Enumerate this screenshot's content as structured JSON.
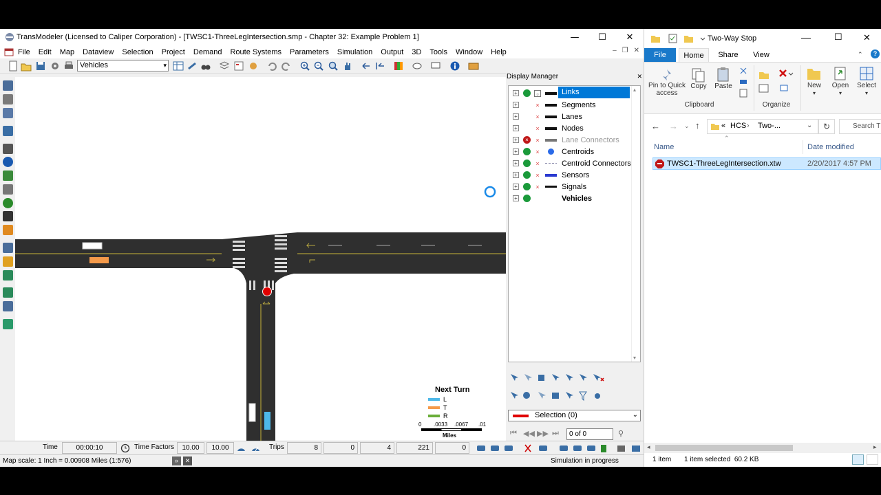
{
  "transmodeler": {
    "title": "TransModeler (Licensed to Caliper Corporation) - [TWSC1-ThreeLegIntersection.smp - Chapter 32: Example Problem 1]",
    "menu": [
      "File",
      "Edit",
      "Map",
      "Dataview",
      "Selection",
      "Project",
      "Demand",
      "Route Systems",
      "Parameters",
      "Simulation",
      "Output",
      "3D",
      "Tools",
      "Window",
      "Help"
    ],
    "layer_select": "Vehicles",
    "display_manager": {
      "title": "Display Manager",
      "layers": [
        {
          "label": "Links",
          "visible": true,
          "selected": true
        },
        {
          "label": "Segments",
          "visible": null
        },
        {
          "label": "Lanes",
          "visible": null
        },
        {
          "label": "Nodes",
          "visible": null
        },
        {
          "label": "Lane Connectors",
          "visible": false
        },
        {
          "label": "Centroids",
          "visible": true
        },
        {
          "label": "Centroid Connectors",
          "visible": true
        },
        {
          "label": "Sensors",
          "visible": true
        },
        {
          "label": "Signals",
          "visible": true
        },
        {
          "label": "Vehicles",
          "visible": true
        }
      ],
      "selection": "Selection (0)",
      "record_count": "0 of 0"
    },
    "legend": {
      "title": "Next Turn",
      "items": [
        {
          "label": "L",
          "color": "#4db8e8"
        },
        {
          "label": "T",
          "color": "#f59a4a"
        },
        {
          "label": "R",
          "color": "#6aae3a"
        }
      ],
      "scale_ticks": [
        "0",
        ".0033",
        ".0067",
        ".01"
      ],
      "scale_unit": "Miles"
    },
    "sim_bar": {
      "time_label": "Time",
      "time_value": "00:00:10",
      "time_factors_label": "Time Factors",
      "factor1": "10.00",
      "factor2": "10.00",
      "trips_label": "Trips",
      "trips": [
        "8",
        "0",
        "4",
        "221",
        "0"
      ]
    },
    "status": {
      "map_scale": "Map scale: 1 Inch = 0.00908 Miles (1:576)",
      "sim_status": "Simulation in progress"
    }
  },
  "explorer": {
    "title": "Two-Way Stop",
    "tabs": [
      "File",
      "Home",
      "Share",
      "View"
    ],
    "ribbon": {
      "pin": "Pin to Quick access",
      "copy": "Copy",
      "paste": "Paste",
      "clipboard": "Clipboard",
      "organize": "Organize",
      "new": "New",
      "open": "Open",
      "select": "Select"
    },
    "address": [
      "HCS",
      "Two-..."
    ],
    "address_prefix": "«",
    "search_placeholder": "Search T",
    "columns": {
      "name": "Name",
      "date": "Date modified"
    },
    "file": {
      "name": "TWSC1-ThreeLegIntersection.xtw",
      "date": "2/20/2017 4:57 PM"
    },
    "status": {
      "items": "1 item",
      "selected": "1 item selected  60.2 KB"
    }
  },
  "colors": {
    "road": "#2f2f2f",
    "centerline": "#c8b53a",
    "selection_blue": "#0078d7",
    "signal_red": "#e00000"
  }
}
